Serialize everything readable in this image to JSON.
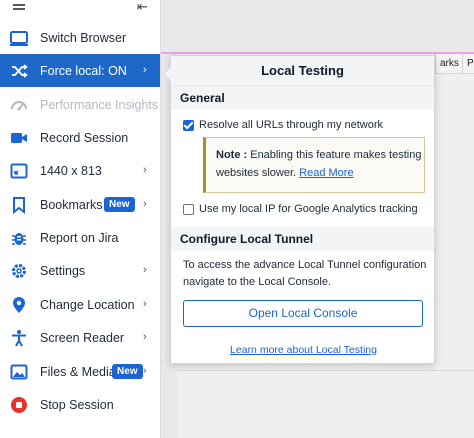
{
  "background": {
    "tabs": [
      "arks",
      "Pi"
    ]
  },
  "sidebar": {
    "menu_icon": "hamburger-icon",
    "collapse_icon": "collapse-left-icon",
    "items": [
      {
        "label": "Switch Browser",
        "icon": "browser-window-icon"
      },
      {
        "label": "Force local: ON",
        "icon": "shuffle-icon",
        "active": true,
        "chevron": true
      },
      {
        "label": "Performance Insights",
        "icon": "gauge-icon",
        "disabled": true
      },
      {
        "label": "Record Session",
        "icon": "video-camera-icon"
      },
      {
        "label": "1440 x 813",
        "icon": "resize-icon",
        "chevron": true
      },
      {
        "label": "Bookmarks",
        "icon": "bookmark-icon",
        "badge": "New",
        "chevron": true
      },
      {
        "label": "Report on Jira",
        "icon": "bug-icon"
      },
      {
        "label": "Settings",
        "icon": "gear-icon",
        "chevron": true
      },
      {
        "label": "Change Location",
        "icon": "location-pin-icon",
        "chevron": true
      },
      {
        "label": "Screen Reader",
        "icon": "accessibility-icon",
        "chevron": true
      },
      {
        "label": "Files & Media",
        "icon": "image-icon",
        "badge": "New",
        "chevron": true
      },
      {
        "label": "Stop Session",
        "icon": "stop-icon"
      }
    ],
    "accent_color": "#1e68c9"
  },
  "popover": {
    "title": "Local Testing",
    "general_heading": "General",
    "resolve_label": "Resolve all URLs through my network",
    "resolve_checked": true,
    "note_label": "Note :",
    "note_text": " Enabling this feature makes testing websites slower. ",
    "note_link": "Read More",
    "ga_label": "Use my local IP for Google Analytics tracking",
    "ga_checked": false,
    "tunnel_heading": "Configure Local Tunnel",
    "tunnel_text": "To access the advance Local Tunnel configuration navigate to the Local Console.",
    "button_label": "Open Local Console",
    "learn_more": "Learn more about Local Testing"
  }
}
